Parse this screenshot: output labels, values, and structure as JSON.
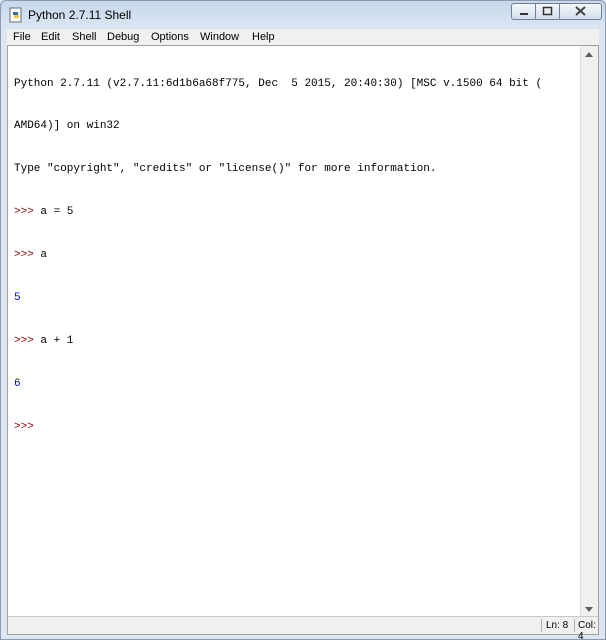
{
  "window": {
    "title": "Python 2.7.11 Shell"
  },
  "menubar": {
    "items": [
      "File",
      "Edit",
      "Shell",
      "Debug",
      "Options",
      "Window",
      "Help"
    ]
  },
  "console": {
    "lines": [
      {
        "kind": "out",
        "text": "Python 2.7.11 (v2.7.11:6d1b6a68f775, Dec  5 2015, 20:40:30) [MSC v.1500 64 bit ("
      },
      {
        "kind": "out",
        "text": "AMD64)] on win32"
      },
      {
        "kind": "out",
        "text": "Type \"copyright\", \"credits\" or \"license()\" for more information."
      },
      {
        "kind": "prompt",
        "prompt": ">>> ",
        "text": "a = 5"
      },
      {
        "kind": "prompt",
        "prompt": ">>> ",
        "text": "a"
      },
      {
        "kind": "result",
        "text": "5"
      },
      {
        "kind": "prompt",
        "prompt": ">>> ",
        "text": "a + 1"
      },
      {
        "kind": "result",
        "text": "6"
      },
      {
        "kind": "prompt",
        "prompt": ">>> ",
        "text": ""
      }
    ]
  },
  "statusbar": {
    "line": "Ln: 8",
    "col": "Col: 4"
  }
}
